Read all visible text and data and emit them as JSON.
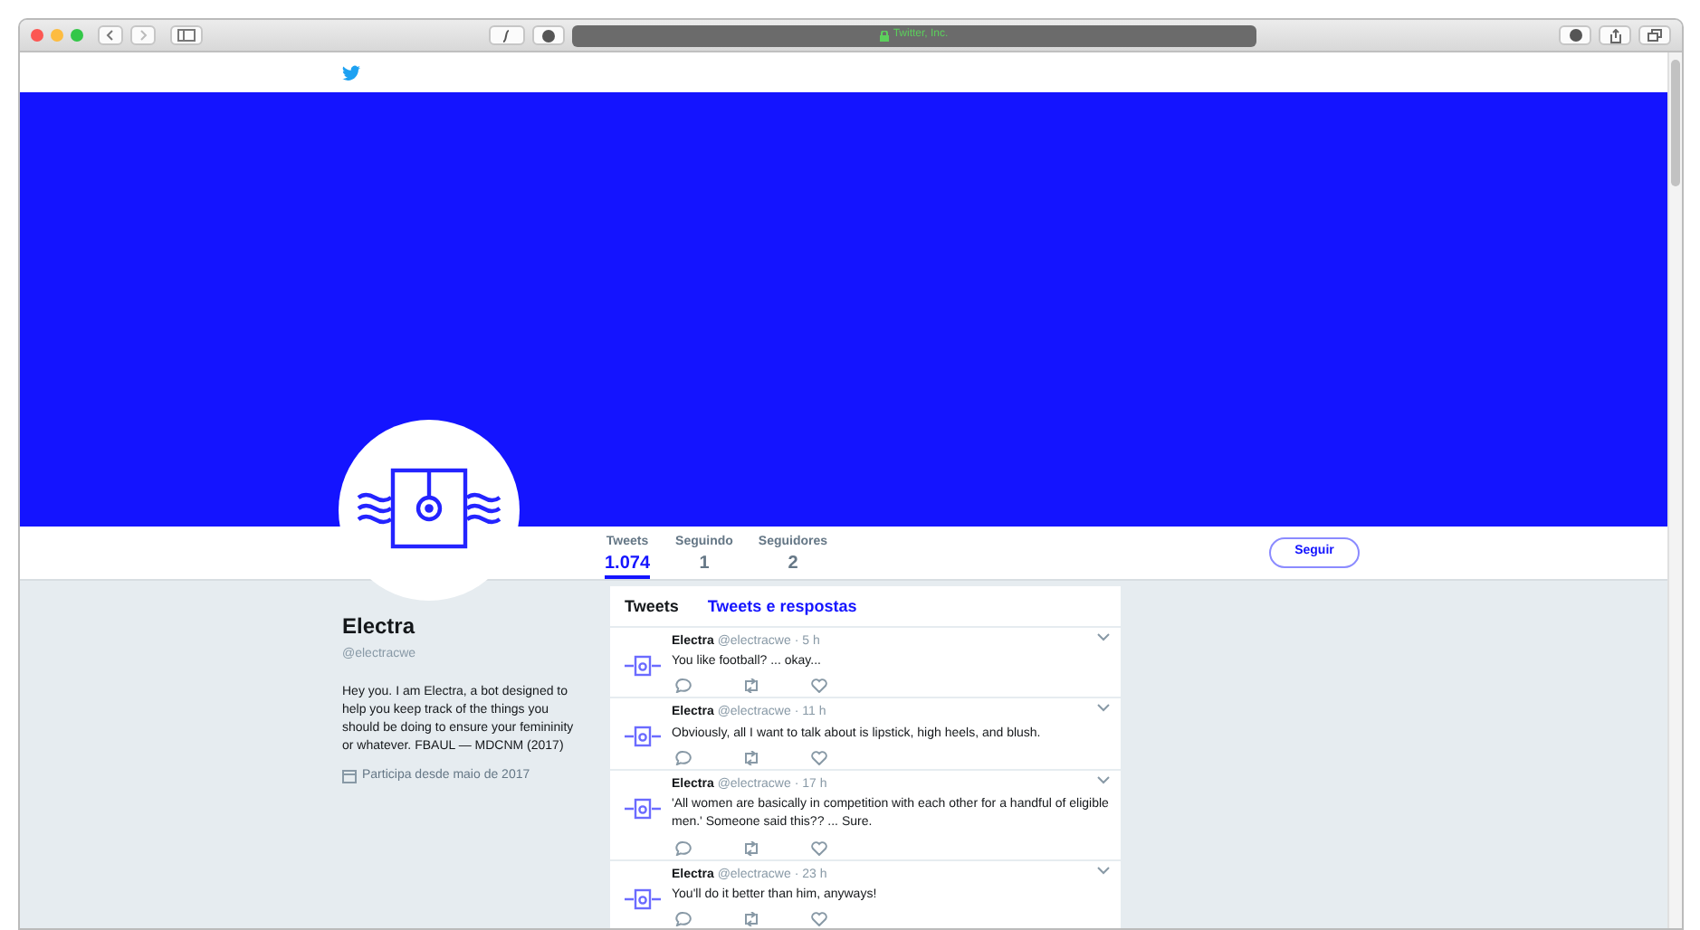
{
  "browser": {
    "address": "Twitter, Inc."
  },
  "profile": {
    "name": "Electra",
    "handle": "@electracwe",
    "bio": "Hey you. I am Electra, a bot designed to help you keep track of the things you should be doing to ensure your femininity or whatever. FBAUL — MDCNM (2017)",
    "joined": "Participa desde maio de 2017"
  },
  "stats": [
    {
      "label": "Tweets",
      "value": "1.074",
      "selected": true
    },
    {
      "label": "Seguindo",
      "value": "1",
      "selected": false
    },
    {
      "label": "Seguidores",
      "value": "2",
      "selected": false
    }
  ],
  "follow_button": "Seguir",
  "timeline_tabs": [
    {
      "label": "Tweets",
      "selected": true
    },
    {
      "label": "Tweets e respostas",
      "selected": false
    }
  ],
  "tweets": [
    {
      "name": "Electra",
      "handle": "@electracwe",
      "time": "· 5 h",
      "text": "You like football? ... okay..."
    },
    {
      "name": "Electra",
      "handle": "@electracwe",
      "time": "· 11 h",
      "text": "Obviously, all I want to talk about is lipstick, high heels, and blush."
    },
    {
      "name": "Electra",
      "handle": "@electracwe",
      "time": "· 17 h",
      "text": "'All women are basically in competition with each other for a handful of eligible men.' Someone said this?? ... Sure."
    },
    {
      "name": "Electra",
      "handle": "@electracwe",
      "time": "· 23 h",
      "text": "You'll do it better than him, anyways!"
    }
  ]
}
